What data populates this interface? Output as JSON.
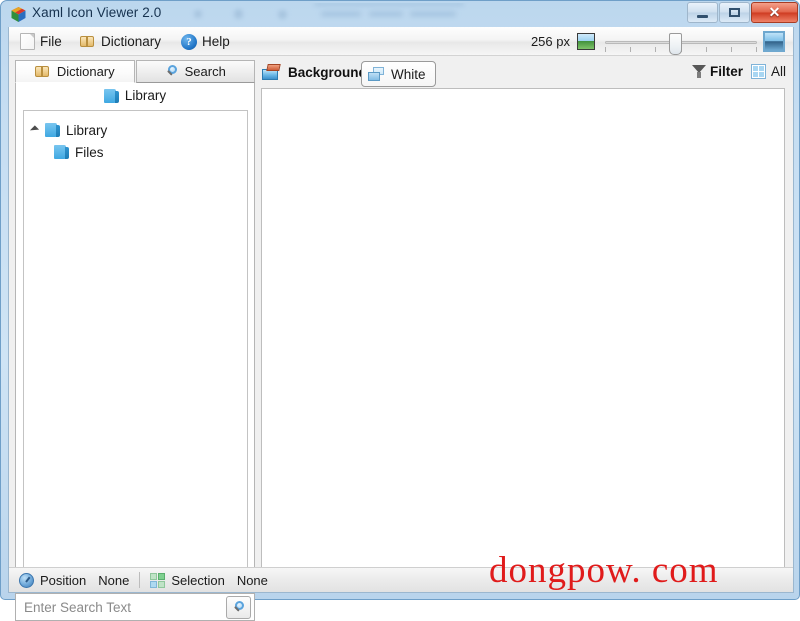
{
  "window": {
    "title": "Xaml Icon Viewer 2.0",
    "app_icon": "xaml-pinwheel-icon",
    "controls": {
      "minimize": "minimize-button",
      "maximize": "restore-button",
      "close_glyph": "✕"
    }
  },
  "menu": {
    "items": [
      {
        "label": "File",
        "icon": "page-icon"
      },
      {
        "label": "Dictionary",
        "icon": "book-icon"
      },
      {
        "label": "Help",
        "icon": "help-circle-icon",
        "glyph": "?"
      }
    ],
    "zoom": {
      "size_label": "256 px",
      "small_icon": "small-image-icon",
      "large_icon": "large-image-icon",
      "slider_value": 45
    }
  },
  "left_pane": {
    "tabs": [
      {
        "label": "Dictionary",
        "icon": "book-icon",
        "active": true
      },
      {
        "label": "Search",
        "icon": "magnifier-icon",
        "active": false
      }
    ],
    "header": {
      "label": "Library",
      "icon": "library-cube-icon"
    },
    "tree": [
      {
        "label": "Library",
        "icon": "library-cube-icon",
        "expanded": true,
        "level": 0
      },
      {
        "label": "Files",
        "icon": "library-cube-icon",
        "expanded": false,
        "level": 1
      }
    ],
    "search": {
      "value": "",
      "placeholder": "Enter Search Text",
      "button_icon": "magnifier-icon"
    }
  },
  "right_pane": {
    "background_label": "Background",
    "background_icon": "background-picture-icon",
    "background_value": "White",
    "background_value_icon": "layers-icon",
    "filter_label": "Filter",
    "filter_icon": "funnel-icon",
    "all_label": "All",
    "all_icon": "grid-four-pane-icon",
    "canvas_empty": ""
  },
  "status_bar": {
    "position_label": "Position",
    "position_value": "None",
    "position_icon": "position-clock-icon",
    "selection_label": "Selection",
    "selection_value": "None",
    "selection_icon": "selection-grid-icon"
  },
  "watermark": {
    "text": "dongpow. com",
    "color": "#e01b1b"
  },
  "colors": {
    "window_border": "#6f9fc8",
    "title_text": "#16324f",
    "close_button": "#cf3c22",
    "accent_blue": "#3fa8e2",
    "canvas": "#ffffff"
  }
}
